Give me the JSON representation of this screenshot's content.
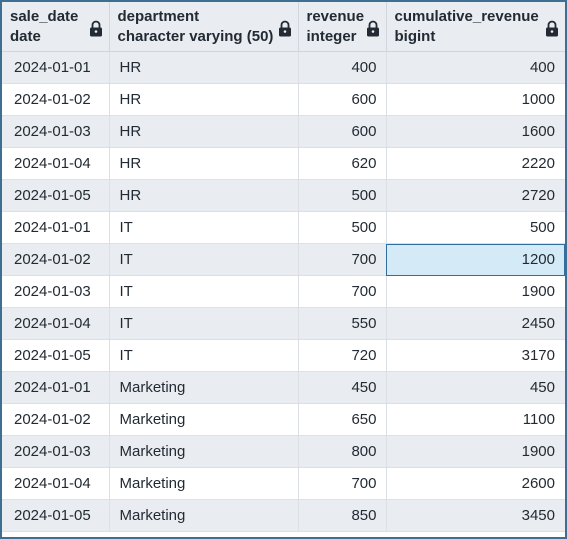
{
  "columns": [
    {
      "name": "sale_date",
      "type": "date",
      "locked": true
    },
    {
      "name": "department",
      "type": "character varying (50)",
      "locked": true
    },
    {
      "name": "revenue",
      "type": "integer",
      "locked": true
    },
    {
      "name": "cumulative_revenue",
      "type": "bigint",
      "locked": true
    }
  ],
  "rows": [
    [
      "2024-01-01",
      "HR",
      "400",
      "400"
    ],
    [
      "2024-01-02",
      "HR",
      "600",
      "1000"
    ],
    [
      "2024-01-03",
      "HR",
      "600",
      "1600"
    ],
    [
      "2024-01-04",
      "HR",
      "620",
      "2220"
    ],
    [
      "2024-01-05",
      "HR",
      "500",
      "2720"
    ],
    [
      "2024-01-01",
      "IT",
      "500",
      "500"
    ],
    [
      "2024-01-02",
      "IT",
      "700",
      "1200"
    ],
    [
      "2024-01-03",
      "IT",
      "700",
      "1900"
    ],
    [
      "2024-01-04",
      "IT",
      "550",
      "2450"
    ],
    [
      "2024-01-05",
      "IT",
      "720",
      "3170"
    ],
    [
      "2024-01-01",
      "Marketing",
      "450",
      "450"
    ],
    [
      "2024-01-02",
      "Marketing",
      "650",
      "1100"
    ],
    [
      "2024-01-03",
      "Marketing",
      "800",
      "1900"
    ],
    [
      "2024-01-04",
      "Marketing",
      "700",
      "2600"
    ],
    [
      "2024-01-05",
      "Marketing",
      "850",
      "3450"
    ]
  ],
  "selected_cell": {
    "row": 6,
    "column": 3
  },
  "colors": {
    "border": "#3f6e93",
    "header_bg": "#e9ecf0",
    "stripe_bg": "#e9ecf0",
    "selected_bg": "#d5eaf7",
    "text": "#222b33"
  },
  "icons": {
    "column_lock": "lock-icon"
  }
}
